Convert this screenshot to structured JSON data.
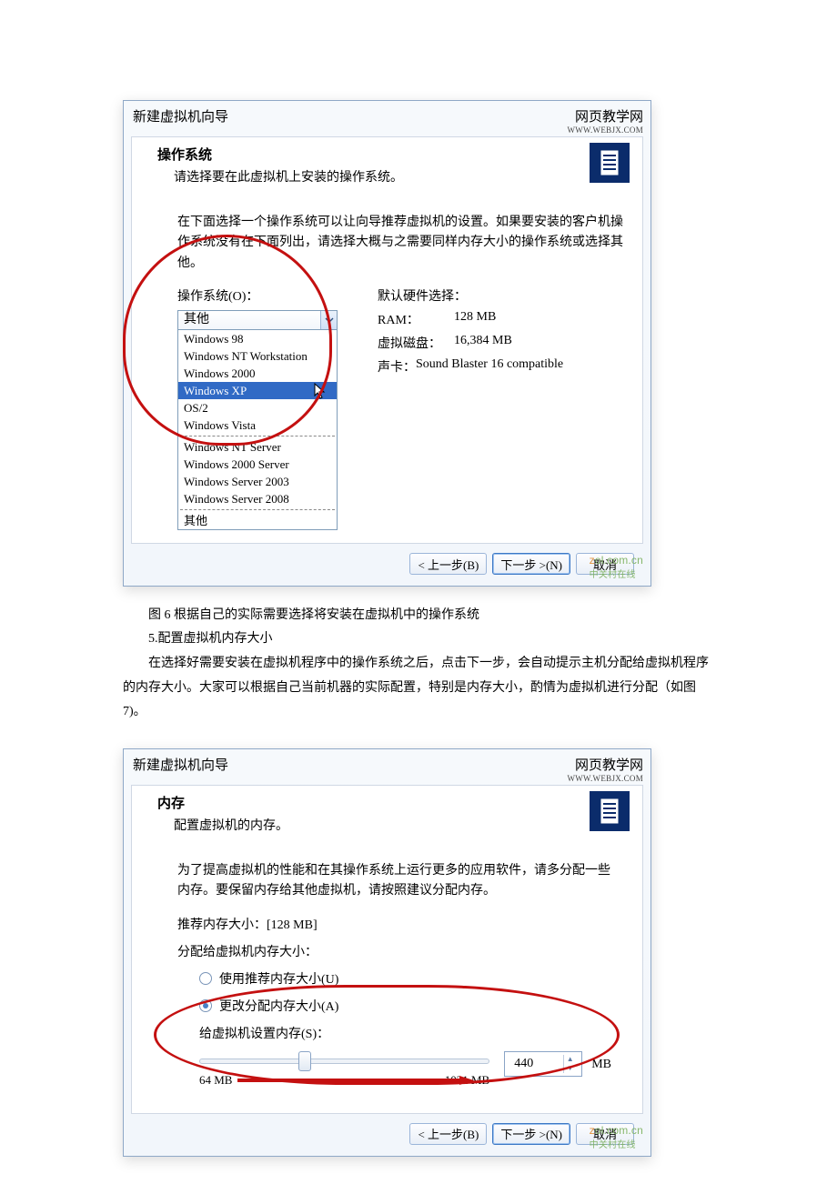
{
  "dlg1": {
    "title": "新建虚拟机向导",
    "watermark_top": "网页教学网",
    "watermark_sub": "WWW.WEBJX.COM",
    "header_title": "操作系统",
    "header_sub": "请选择要在此虚拟机上安装的操作系统。",
    "desc": "在下面选择一个操作系统可以让向导推荐虚拟机的设置。如果要安装的客户机操作系统没有在下面列出，请选择大概与之需要同样内存大小的操作系统或选择其他。",
    "os_label": "操作系统(O)：",
    "hw_label": "默认硬件选择：",
    "hw_ram_k": "RAM：",
    "hw_ram_v": "128 MB",
    "hw_disk_k": "虚拟磁盘：",
    "hw_disk_v": "16,384 MB",
    "hw_sound_k": "声卡：",
    "hw_sound_v": "Sound Blaster 16 compatible",
    "dd_selected": "其他",
    "dd_opts_a": [
      "Windows 98",
      "Windows NT Workstation",
      "Windows 2000",
      "Windows XP",
      "OS/2",
      "Windows Vista"
    ],
    "dd_hi_index": 3,
    "dd_opts_b": [
      "Windows NT Server",
      "Windows 2000 Server",
      "Windows Server 2003",
      "Windows Server 2008"
    ],
    "dd_opts_c": [
      "其他"
    ],
    "btn_prev": "< 上一步(B)",
    "btn_next": "下一步 >(N)",
    "btn_cancel": "取消",
    "zol_main": "zol.com.cn",
    "zol_sub": "中关村在线"
  },
  "article": {
    "caption": "图 6 根据自己的实际需要选择将安装在虚拟机中的操作系统",
    "step": "5.配置虚拟机内存大小",
    "para": "在选择好需要安装在虚拟机程序中的操作系统之后，点击下一步，会自动提示主机分配给虚拟机程序的内存大小。大家可以根据自己当前机器的实际配置，特别是内存大小，酌情为虚拟机进行分配（如图 7)。"
  },
  "dlg2": {
    "title": "新建虚拟机向导",
    "watermark_top": "网页教学网",
    "watermark_sub": "WWW.WEBJX.COM",
    "header_title": "内存",
    "header_sub": "配置虚拟机的内存。",
    "desc": "为了提高虚拟机的性能和在其操作系统上运行更多的应用软件，请多分配一些内存。要保留内存给其他虚拟机，请按照建议分配内存。",
    "rec_label": "推荐内存大小：[128 MB]",
    "alloc_label": "分配给虚拟机内存大小：",
    "radio_rec": "使用推荐内存大小(U)",
    "radio_custom": "更改分配内存大小(A)",
    "set_label": "给虚拟机设置内存(S)：",
    "min": "64 MB",
    "max": "1021 MB",
    "value": "440",
    "unit": "MB",
    "btn_prev": "< 上一步(B)",
    "btn_next": "下一步 >(N)",
    "btn_cancel": "取消",
    "zol_main": "zol.com.cn",
    "zol_sub": "中关村在线"
  }
}
